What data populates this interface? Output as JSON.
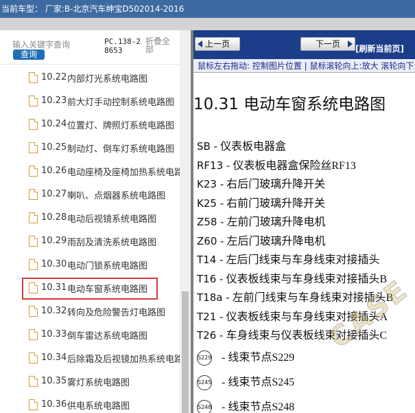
{
  "titlebar": {
    "text": "当前车型：  厂家:B-北京汽车绅宝D502014-2016"
  },
  "search": {
    "placeholder": "输入关键字查询",
    "button_label": "查询",
    "pc_code": "PC.138-28653",
    "collapse_label": "折叠全部"
  },
  "list": [
    {
      "num": "10.22",
      "label": "内部灯光系统电路图"
    },
    {
      "num": "10.23",
      "label": "前大灯手动控制系统电路图"
    },
    {
      "num": "10.24",
      "label": "位置灯、牌照灯系统电路图"
    },
    {
      "num": "10.25",
      "label": "制动灯、倒车灯系统电路图"
    },
    {
      "num": "10.26",
      "label": "电动座椅及座椅加热系统电路图"
    },
    {
      "num": "10.27",
      "label": "喇叭、点烟器系统电路图"
    },
    {
      "num": "10.28",
      "label": "电动后视镜系统电路图"
    },
    {
      "num": "10.29",
      "label": "雨刮及清洗系统电路图"
    },
    {
      "num": "10.30",
      "label": "电动门锁系统电路图"
    },
    {
      "num": "10.31",
      "label": "电动车窗系统电路图",
      "selected": true
    },
    {
      "num": "10.32",
      "label": "转向及危险警告灯电路图"
    },
    {
      "num": "10.33",
      "label": "倒车雷达系统电路图"
    },
    {
      "num": "10.34",
      "label": "后除霜及后视镜加热系统电路图"
    },
    {
      "num": "10.35",
      "label": "雾灯系统电路图"
    },
    {
      "num": "10.36",
      "label": "供电系统电路图"
    }
  ],
  "viewer": {
    "prev_label": "上一页",
    "next_label": "下一页",
    "refresh_label": "[刷新当前页]",
    "hint": "鼠标左右拖动: 控制图片位置 | 鼠标滚轮向上:放大  滚轮向下:缩小",
    "title": "10.31  电动车窗系统电路图",
    "legend": [
      {
        "code": "SB -",
        "text": "仪表板电器盒"
      },
      {
        "code": "RF13 -",
        "text": "仪表板电器盒保险丝RF13"
      },
      {
        "code": "K23 -",
        "text": "右后门玻璃升降开关"
      },
      {
        "code": "K25 -",
        "text": "右前门玻璃升降开关"
      },
      {
        "code": "Z58 -",
        "text": "左前门玻璃升降电机"
      },
      {
        "code": "Z60 -",
        "text": "左后门玻璃升降电机"
      },
      {
        "code": "T14 -",
        "text": "左后门线束与车身线束对接插头"
      },
      {
        "code": "T16 -",
        "text": "仪表板线束与车身线束对接插头B"
      },
      {
        "code": "T18a -",
        "text": "左前门线束与车身线束对接插头B"
      },
      {
        "code": "T21 -",
        "text": "仪表板线束与车身线束对接插头A"
      },
      {
        "code": "T26 -",
        "text": "车身线束与仪表板线束对接插头C"
      }
    ],
    "nodes": [
      {
        "badge": "S229",
        "text": "-  线束节点S229"
      },
      {
        "badge": "S245",
        "text": "-  线束节点S245"
      },
      {
        "badge": "S248",
        "text": "-  线束节点S248"
      }
    ],
    "watermark": "CASE"
  },
  "colors": {
    "titlebar": "#3d6aa1",
    "toolbar": "#1c3d8a",
    "selection_border": "#d33a3a",
    "search_button": "#1f6fb8"
  }
}
